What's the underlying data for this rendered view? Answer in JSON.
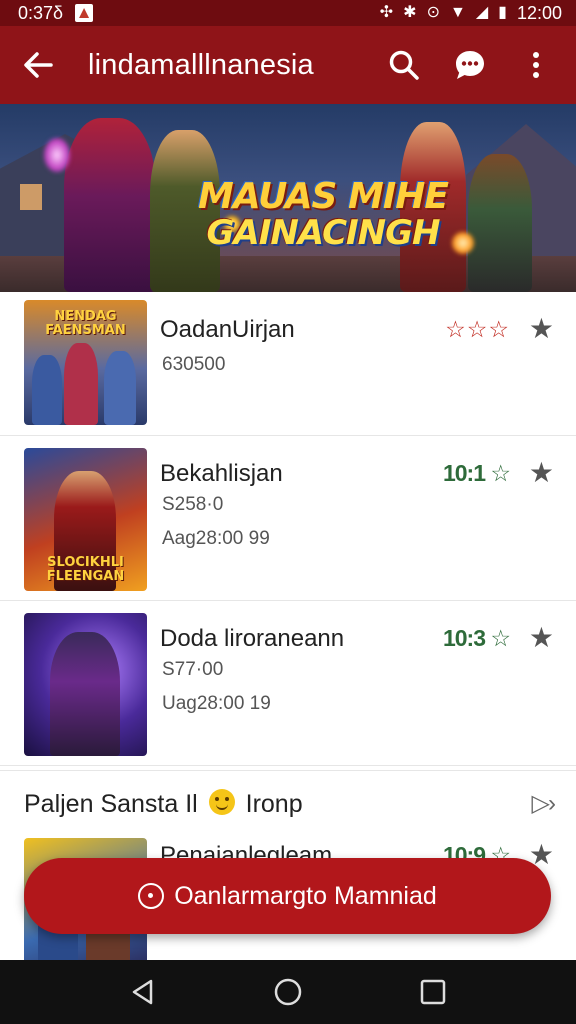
{
  "status_bar": {
    "time_left": "0:37δ",
    "time_right": "12:00"
  },
  "app_bar": {
    "title": "lindamalllnanesia",
    "back_icon": "arrow-left-icon",
    "search_icon": "search-icon",
    "chat_icon": "chat-bubble-icon",
    "more_icon": "more-vert-icon"
  },
  "hero": {
    "title_line1": "MAUAS MIHE",
    "title_line2": "GAINACINGH"
  },
  "games": [
    {
      "name": "OadanUirjan",
      "line1": "630500",
      "line2": "",
      "rating": "☆☆☆",
      "rating_style": "stars",
      "thumb_caption": "NENDAG FAENSMAN"
    },
    {
      "name": "Bekahlisjan",
      "line1": "S258·0",
      "line2": "Aag28:00 99",
      "rating": "10:1 ☆",
      "rating_style": "score",
      "thumb_caption": "SLOCIKHLI FLEENGAN"
    },
    {
      "name": "Doda liroraneann",
      "line1": "S77·00",
      "line2": "Uag28:00 19",
      "rating": "10:3 ☆",
      "rating_style": "score",
      "thumb_caption": ""
    }
  ],
  "section": {
    "title_before": "Paljen Sansta Il",
    "title_after": "Ironp",
    "arrows": "▷›"
  },
  "partial_game": {
    "name": "Penaianlegleam",
    "rating": "10:9 ☆"
  },
  "fab": {
    "label": "Oanlarmargto Mamniad"
  },
  "colors": {
    "status_bar": "#6e0c10",
    "app_bar": "#8f1418",
    "fab": "#b2171b",
    "rating_green": "#2e6b3a",
    "rating_red": "#c0281e"
  }
}
